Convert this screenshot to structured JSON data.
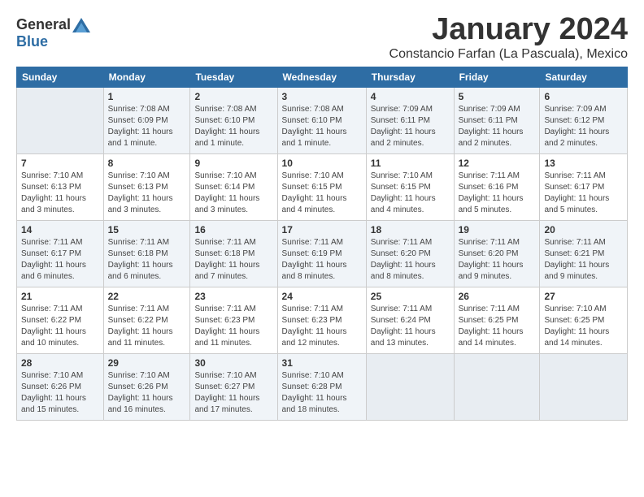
{
  "logo": {
    "general": "General",
    "blue": "Blue"
  },
  "title": "January 2024",
  "location": "Constancio Farfan (La Pascuala), Mexico",
  "days_of_week": [
    "Sunday",
    "Monday",
    "Tuesday",
    "Wednesday",
    "Thursday",
    "Friday",
    "Saturday"
  ],
  "weeks": [
    [
      {
        "day": "",
        "sunrise": "",
        "sunset": "",
        "daylight": ""
      },
      {
        "day": "1",
        "sunrise": "Sunrise: 7:08 AM",
        "sunset": "Sunset: 6:09 PM",
        "daylight": "Daylight: 11 hours and 1 minute."
      },
      {
        "day": "2",
        "sunrise": "Sunrise: 7:08 AM",
        "sunset": "Sunset: 6:10 PM",
        "daylight": "Daylight: 11 hours and 1 minute."
      },
      {
        "day": "3",
        "sunrise": "Sunrise: 7:08 AM",
        "sunset": "Sunset: 6:10 PM",
        "daylight": "Daylight: 11 hours and 1 minute."
      },
      {
        "day": "4",
        "sunrise": "Sunrise: 7:09 AM",
        "sunset": "Sunset: 6:11 PM",
        "daylight": "Daylight: 11 hours and 2 minutes."
      },
      {
        "day": "5",
        "sunrise": "Sunrise: 7:09 AM",
        "sunset": "Sunset: 6:11 PM",
        "daylight": "Daylight: 11 hours and 2 minutes."
      },
      {
        "day": "6",
        "sunrise": "Sunrise: 7:09 AM",
        "sunset": "Sunset: 6:12 PM",
        "daylight": "Daylight: 11 hours and 2 minutes."
      }
    ],
    [
      {
        "day": "7",
        "sunrise": "Sunrise: 7:10 AM",
        "sunset": "Sunset: 6:13 PM",
        "daylight": "Daylight: 11 hours and 3 minutes."
      },
      {
        "day": "8",
        "sunrise": "Sunrise: 7:10 AM",
        "sunset": "Sunset: 6:13 PM",
        "daylight": "Daylight: 11 hours and 3 minutes."
      },
      {
        "day": "9",
        "sunrise": "Sunrise: 7:10 AM",
        "sunset": "Sunset: 6:14 PM",
        "daylight": "Daylight: 11 hours and 3 minutes."
      },
      {
        "day": "10",
        "sunrise": "Sunrise: 7:10 AM",
        "sunset": "Sunset: 6:15 PM",
        "daylight": "Daylight: 11 hours and 4 minutes."
      },
      {
        "day": "11",
        "sunrise": "Sunrise: 7:10 AM",
        "sunset": "Sunset: 6:15 PM",
        "daylight": "Daylight: 11 hours and 4 minutes."
      },
      {
        "day": "12",
        "sunrise": "Sunrise: 7:11 AM",
        "sunset": "Sunset: 6:16 PM",
        "daylight": "Daylight: 11 hours and 5 minutes."
      },
      {
        "day": "13",
        "sunrise": "Sunrise: 7:11 AM",
        "sunset": "Sunset: 6:17 PM",
        "daylight": "Daylight: 11 hours and 5 minutes."
      }
    ],
    [
      {
        "day": "14",
        "sunrise": "Sunrise: 7:11 AM",
        "sunset": "Sunset: 6:17 PM",
        "daylight": "Daylight: 11 hours and 6 minutes."
      },
      {
        "day": "15",
        "sunrise": "Sunrise: 7:11 AM",
        "sunset": "Sunset: 6:18 PM",
        "daylight": "Daylight: 11 hours and 6 minutes."
      },
      {
        "day": "16",
        "sunrise": "Sunrise: 7:11 AM",
        "sunset": "Sunset: 6:18 PM",
        "daylight": "Daylight: 11 hours and 7 minutes."
      },
      {
        "day": "17",
        "sunrise": "Sunrise: 7:11 AM",
        "sunset": "Sunset: 6:19 PM",
        "daylight": "Daylight: 11 hours and 8 minutes."
      },
      {
        "day": "18",
        "sunrise": "Sunrise: 7:11 AM",
        "sunset": "Sunset: 6:20 PM",
        "daylight": "Daylight: 11 hours and 8 minutes."
      },
      {
        "day": "19",
        "sunrise": "Sunrise: 7:11 AM",
        "sunset": "Sunset: 6:20 PM",
        "daylight": "Daylight: 11 hours and 9 minutes."
      },
      {
        "day": "20",
        "sunrise": "Sunrise: 7:11 AM",
        "sunset": "Sunset: 6:21 PM",
        "daylight": "Daylight: 11 hours and 9 minutes."
      }
    ],
    [
      {
        "day": "21",
        "sunrise": "Sunrise: 7:11 AM",
        "sunset": "Sunset: 6:22 PM",
        "daylight": "Daylight: 11 hours and 10 minutes."
      },
      {
        "day": "22",
        "sunrise": "Sunrise: 7:11 AM",
        "sunset": "Sunset: 6:22 PM",
        "daylight": "Daylight: 11 hours and 11 minutes."
      },
      {
        "day": "23",
        "sunrise": "Sunrise: 7:11 AM",
        "sunset": "Sunset: 6:23 PM",
        "daylight": "Daylight: 11 hours and 11 minutes."
      },
      {
        "day": "24",
        "sunrise": "Sunrise: 7:11 AM",
        "sunset": "Sunset: 6:23 PM",
        "daylight": "Daylight: 11 hours and 12 minutes."
      },
      {
        "day": "25",
        "sunrise": "Sunrise: 7:11 AM",
        "sunset": "Sunset: 6:24 PM",
        "daylight": "Daylight: 11 hours and 13 minutes."
      },
      {
        "day": "26",
        "sunrise": "Sunrise: 7:11 AM",
        "sunset": "Sunset: 6:25 PM",
        "daylight": "Daylight: 11 hours and 14 minutes."
      },
      {
        "day": "27",
        "sunrise": "Sunrise: 7:10 AM",
        "sunset": "Sunset: 6:25 PM",
        "daylight": "Daylight: 11 hours and 14 minutes."
      }
    ],
    [
      {
        "day": "28",
        "sunrise": "Sunrise: 7:10 AM",
        "sunset": "Sunset: 6:26 PM",
        "daylight": "Daylight: 11 hours and 15 minutes."
      },
      {
        "day": "29",
        "sunrise": "Sunrise: 7:10 AM",
        "sunset": "Sunset: 6:26 PM",
        "daylight": "Daylight: 11 hours and 16 minutes."
      },
      {
        "day": "30",
        "sunrise": "Sunrise: 7:10 AM",
        "sunset": "Sunset: 6:27 PM",
        "daylight": "Daylight: 11 hours and 17 minutes."
      },
      {
        "day": "31",
        "sunrise": "Sunrise: 7:10 AM",
        "sunset": "Sunset: 6:28 PM",
        "daylight": "Daylight: 11 hours and 18 minutes."
      },
      {
        "day": "",
        "sunrise": "",
        "sunset": "",
        "daylight": ""
      },
      {
        "day": "",
        "sunrise": "",
        "sunset": "",
        "daylight": ""
      },
      {
        "day": "",
        "sunrise": "",
        "sunset": "",
        "daylight": ""
      }
    ]
  ]
}
